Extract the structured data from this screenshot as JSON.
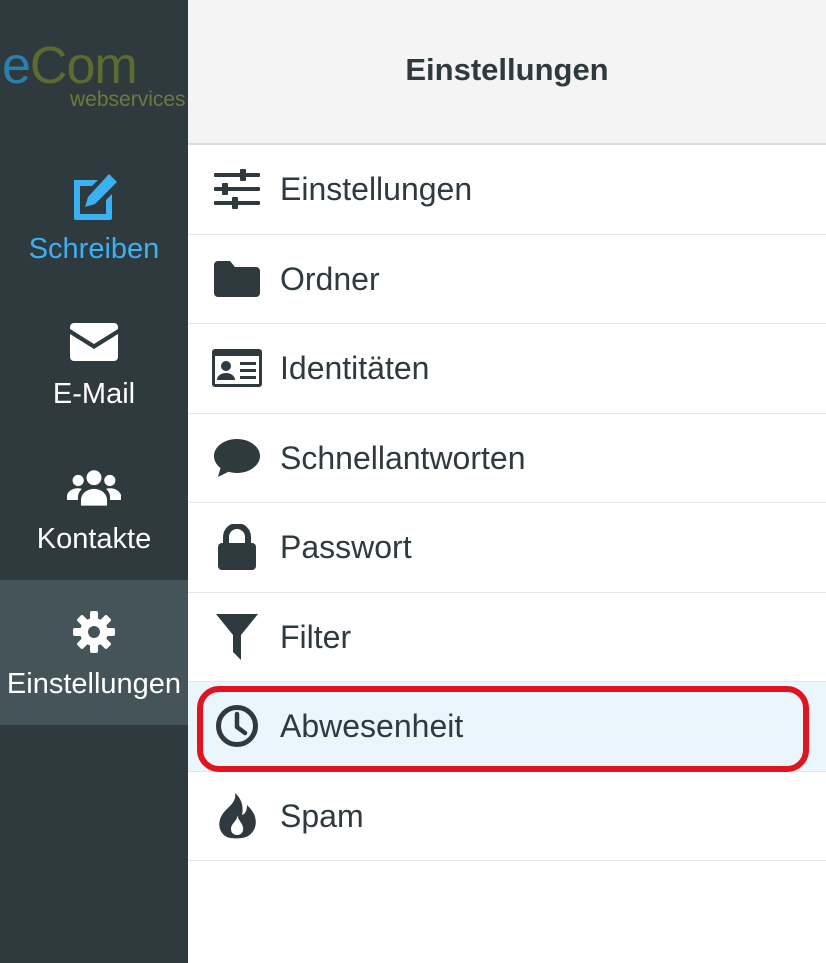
{
  "brand": {
    "logo_letter": "e",
    "logo_rest": "Com",
    "logo_subtitle": "webservices"
  },
  "sidebar": {
    "items": [
      {
        "label": "Schreiben",
        "icon": "edit-icon",
        "active": false
      },
      {
        "label": "E-Mail",
        "icon": "envelope-icon",
        "active": false
      },
      {
        "label": "Kontakte",
        "icon": "users-icon",
        "active": false
      },
      {
        "label": "Einstellungen",
        "icon": "gear-icon",
        "active": true
      }
    ]
  },
  "header": {
    "title": "Einstellungen"
  },
  "settings_list": {
    "items": [
      {
        "label": "Einstellungen",
        "icon": "sliders-icon"
      },
      {
        "label": "Ordner",
        "icon": "folder-icon"
      },
      {
        "label": "Identitäten",
        "icon": "id-card-icon"
      },
      {
        "label": "Schnellantworten",
        "icon": "speech-bubble-icon"
      },
      {
        "label": "Passwort",
        "icon": "lock-icon"
      },
      {
        "label": "Filter",
        "icon": "filter-icon"
      },
      {
        "label": "Abwesenheit",
        "icon": "clock-icon",
        "selected": true
      },
      {
        "label": "Spam",
        "icon": "fire-icon"
      }
    ]
  },
  "colors": {
    "sidebar_bg": "#2f3a3f",
    "sidebar_active_bg": "#455459",
    "accent_blue": "#3ab1f0",
    "text_dark": "#2f3a3f",
    "selected_bg": "#eaf6fc",
    "highlight_red": "#e0141e"
  }
}
